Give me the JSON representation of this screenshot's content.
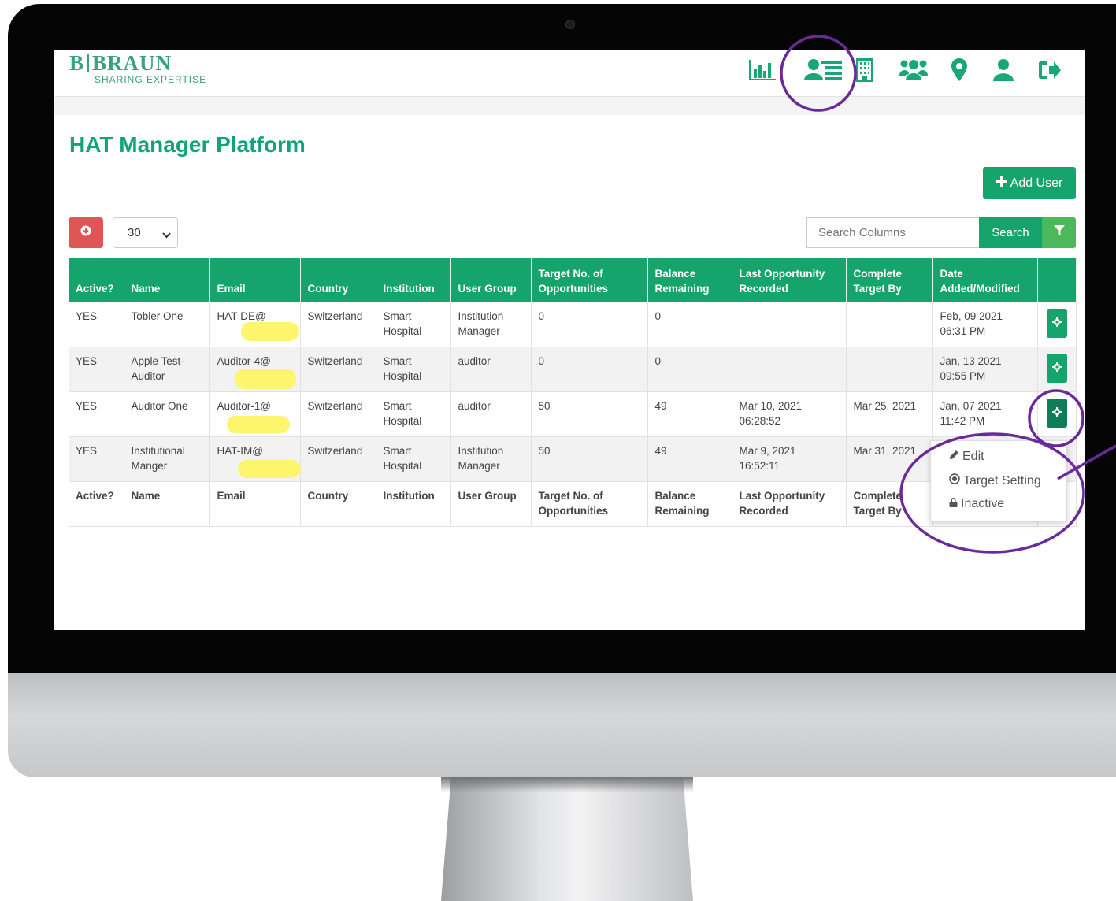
{
  "brand": {
    "name_left": "B",
    "name_right": "BRAUN",
    "tagline": "SHARING EXPERTISE",
    "color": "#19a873"
  },
  "nav": {
    "icons": [
      "chart-icon",
      "user-list-icon",
      "building-icon",
      "users-group-icon",
      "map-pin-icon",
      "user-icon",
      "logout-icon"
    ]
  },
  "page": {
    "title": "HAT Manager Platform",
    "add_user_label": "Add User"
  },
  "controls": {
    "page_size": "30",
    "search_placeholder": "Search Columns",
    "search_label": "Search"
  },
  "table": {
    "headers": [
      "Active?",
      "Name",
      "Email",
      "Country",
      "Institution",
      "User Group",
      "Target No. of Opportunities",
      "Balance Remaining",
      "Last Opportunity Recorded",
      "Complete Target By",
      "Date Added/Modified"
    ],
    "rows": [
      [
        "YES",
        "Tobler One",
        "HAT-DE@",
        "Switzerland",
        "Smart Hospital",
        "Institution Manager",
        "0",
        "0",
        "",
        "",
        "Feb, 09 2021 06:31 PM"
      ],
      [
        "YES",
        "Apple Test-Auditor",
        "Auditor-4@",
        "Switzerland",
        "Smart Hospital",
        "auditor",
        "0",
        "0",
        "",
        "",
        "Jan, 13 2021 09:55 PM"
      ],
      [
        "YES",
        "Auditor One",
        "Auditor-1@",
        "Switzerland",
        "Smart Hospital",
        "auditor",
        "50",
        "49",
        "Mar 10, 2021 06:28:52",
        "Mar 25, 2021",
        "Jan, 07 2021 11:42 PM"
      ],
      [
        "YES",
        "Institutional Manger",
        "HAT-IM@",
        "Switzerland",
        "Smart Hospital",
        "Institution Manager",
        "50",
        "49",
        "Mar 9, 2021 16:52:11",
        "Mar 31, 2021",
        ""
      ]
    ],
    "footer": [
      "Active?",
      "Name",
      "Email",
      "Country",
      "Institution",
      "User Group",
      "Target No. of Opportunities",
      "Balance Remaining",
      "Last Opportunity Recorded",
      "Complete Target By"
    ]
  },
  "menu": {
    "edit": "Edit",
    "target_setting": "Target Setting",
    "inactive": "Inactive"
  },
  "colors": {
    "primary": "#14a46c",
    "danger": "#e05555",
    "filter": "#4cb85c",
    "annotation": "#6a2a9a",
    "highlight": "#fdf56b"
  }
}
